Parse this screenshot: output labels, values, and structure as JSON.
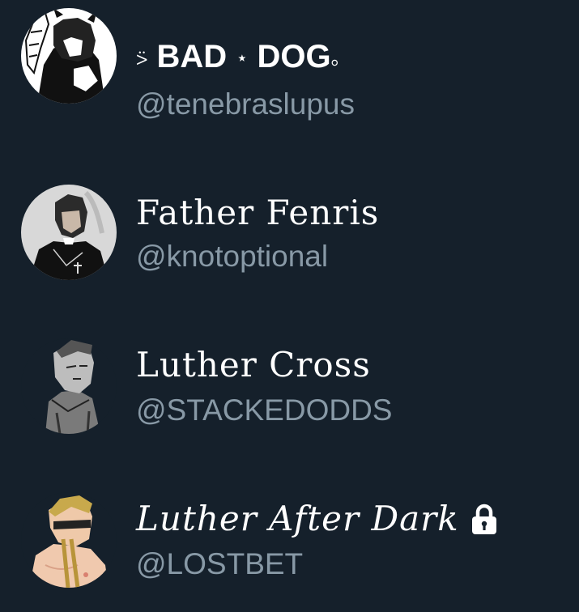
{
  "accounts": [
    {
      "name_prefix": "⍩",
      "name_main1": "BAD",
      "name_star": "⋆",
      "name_main2": "DOG",
      "name_suffix": "。",
      "handle": "@tenebraslupus"
    },
    {
      "name": "Father Fenris",
      "handle": "@knotoptional"
    },
    {
      "name": "Luther Cross",
      "handle": "@STACKEDODDS"
    },
    {
      "name": "Luther After Dark",
      "handle": "@LOSTBET",
      "protected": true
    }
  ],
  "colors": {
    "background": "#15202b",
    "name": "#ffffff",
    "handle": "#8899a6"
  },
  "icons": [
    "avatar-image",
    "lock-icon"
  ]
}
